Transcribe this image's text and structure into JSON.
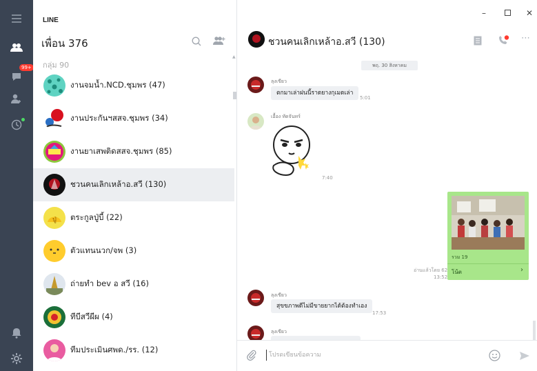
{
  "app_title": "LINE",
  "friends": {
    "title": "เพื่อน 376",
    "group_label": "กลุ่ม 90",
    "groups": [
      {
        "name": "งานจมน้ำ.NCD.ชุมพร (47)"
      },
      {
        "name": "งานประกันฯสสจ.ชุมพร (34)"
      },
      {
        "name": "งานยาเสพติดสสจ.ชุมพร (85)"
      },
      {
        "name": "ชวนคนเลิกเหล้าอ.สวี (130)",
        "selected": true
      },
      {
        "name": "ตระกูลปู่บี้ (22)"
      },
      {
        "name": "ตัวแทนนวก/จพ (3)"
      },
      {
        "name": "ถ่ายทำ bev อ สวี (16)"
      },
      {
        "name": "ทีบีสวีผีผ (4)"
      },
      {
        "name": "ทีมประเมินศพด./รร. (12)"
      }
    ]
  },
  "rail": {
    "badge": "99+"
  },
  "chat": {
    "title": "ชวนคนเลิกเหล้าอ.สวี (130)",
    "date_pill": "พฤ. 30 สิงหาคม",
    "messages": [
      {
        "sender": "ลุงเขียว",
        "text": "ตกมาเล่าฝนนี้ราดยางกุเมดเล่า",
        "time": "5:01"
      },
      {
        "sender": "เอื้อง ทัดจันทร์",
        "time": "7:40"
      },
      {
        "sender": "ลุงเขียว",
        "text": "สุขขภาพดีไม่มีขายยากได้ต้องทำเอง",
        "time": "17:53"
      },
      {
        "sender": "ลุงเขียว"
      }
    ],
    "photo": {
      "count": "รวม 19",
      "link": "โน้ต"
    },
    "read_status": "อ่านแล้วโดย 62",
    "read_time": "13:52",
    "composer_placeholder": "โปรดเขียนข้อความ"
  },
  "colors": {
    "rail": "#3a4453",
    "photo_card": "#a8e68a",
    "badge": "#ff3b30"
  }
}
